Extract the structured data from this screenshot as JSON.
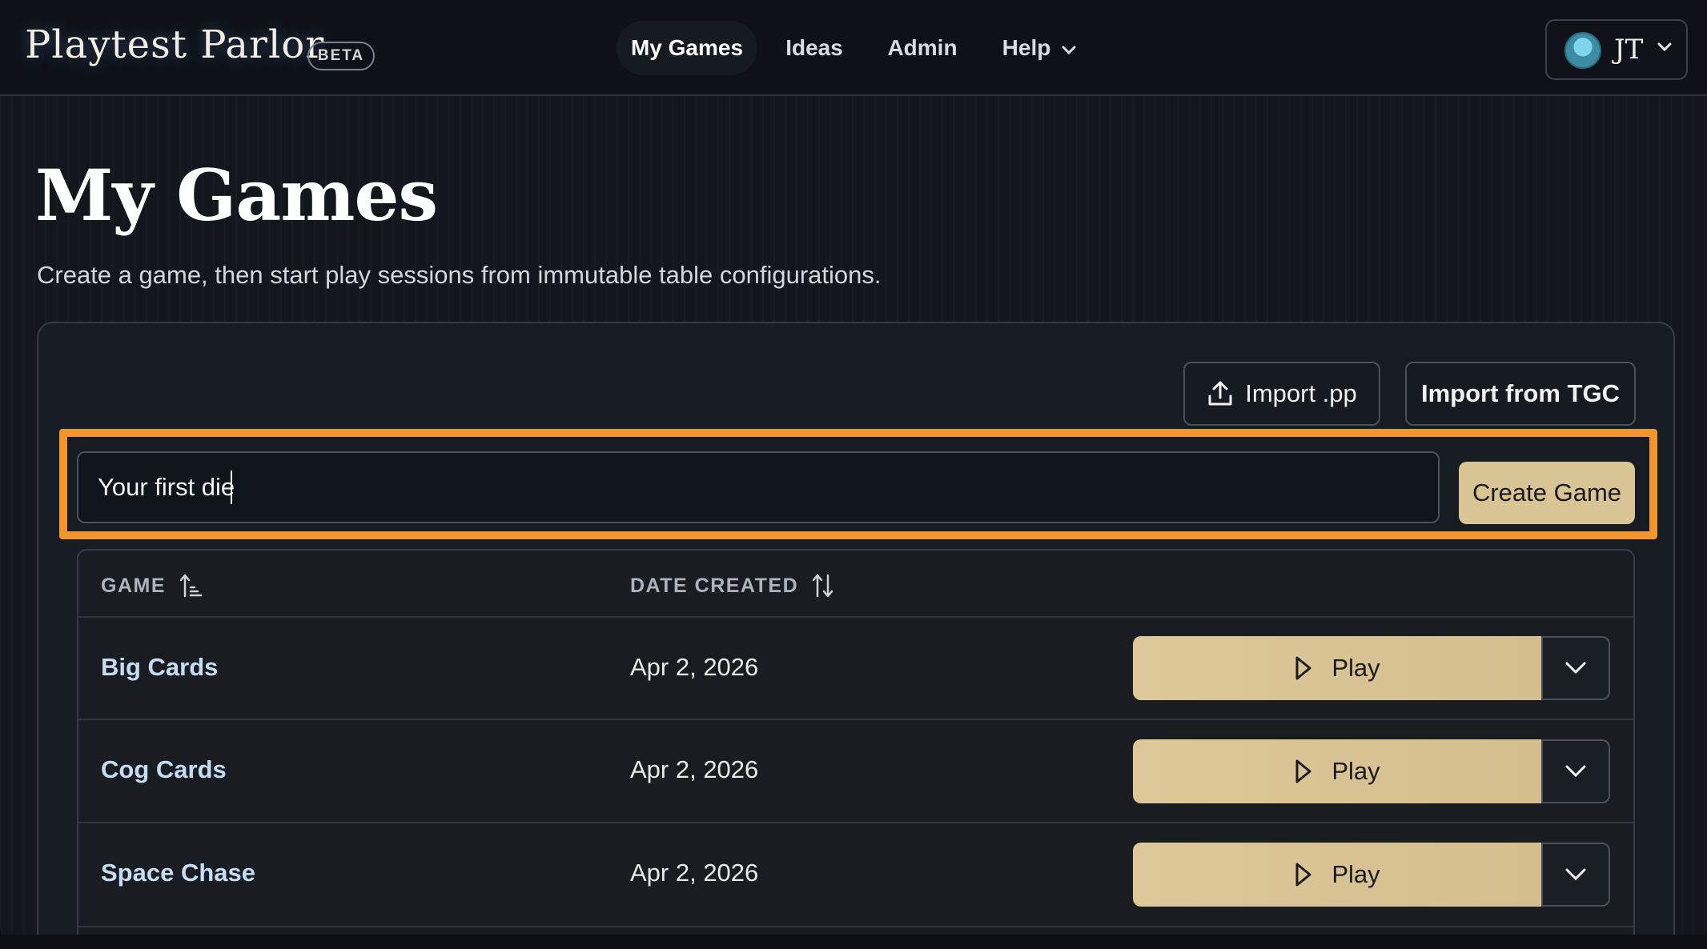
{
  "app": {
    "logo": "Playtest Parlor",
    "badge": "BETA"
  },
  "nav": {
    "items": [
      {
        "label": "My Games",
        "active": true
      },
      {
        "label": "Ideas",
        "active": false
      },
      {
        "label": "Admin",
        "active": false
      },
      {
        "label": "Help",
        "active": false,
        "has_dropdown": true
      }
    ]
  },
  "user": {
    "initials": "JT",
    "avatar_icon": "robot-avatar-icon"
  },
  "page": {
    "title": "My Games",
    "subtitle": "Create a game, then start play sessions from immutable table configurations."
  },
  "toolbar": {
    "import_pp_label": "Import .pp",
    "import_tgc_label": "Import from TGC"
  },
  "create": {
    "input_value": "Your first die",
    "button_label": "Create Game"
  },
  "table": {
    "columns": [
      {
        "label": "GAME",
        "sort": "ascending"
      },
      {
        "label": "DATE CREATED",
        "sort": "none"
      }
    ],
    "rows": [
      {
        "name": "Big Cards",
        "date": "Apr 2, 2026",
        "action": "Play"
      },
      {
        "name": "Cog Cards",
        "date": "Apr 2, 2026",
        "action": "Play"
      },
      {
        "name": "Space Chase",
        "date": "Apr 2, 2026",
        "action": "Play"
      }
    ]
  },
  "colors": {
    "accent_gold": "#d9c495",
    "highlight_orange": "#f1962f",
    "game_link": "#c6dcf3"
  }
}
